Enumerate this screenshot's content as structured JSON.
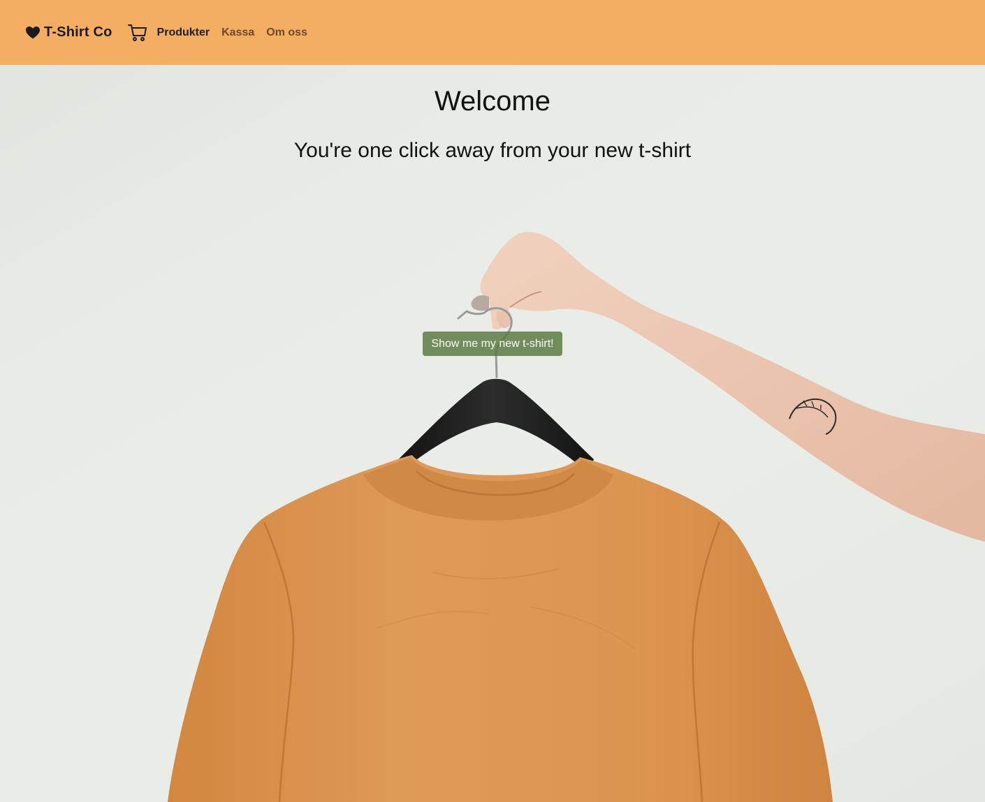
{
  "nav": {
    "brand": "T-Shirt Co",
    "links": [
      {
        "label": "Produkter",
        "active": true
      },
      {
        "label": "Kassa",
        "active": false
      },
      {
        "label": "Om oss",
        "active": false
      }
    ]
  },
  "hero": {
    "title": "Welcome",
    "tagline": "You're one click away from your new t-shirt",
    "cta_label": "Show me my new t-shirt!"
  },
  "colors": {
    "navbar_bg": "#f4ae62",
    "shirt": "#d98f4e",
    "button_bg": "#5f7f44"
  },
  "icons": [
    "heart-icon",
    "cart-icon"
  ]
}
